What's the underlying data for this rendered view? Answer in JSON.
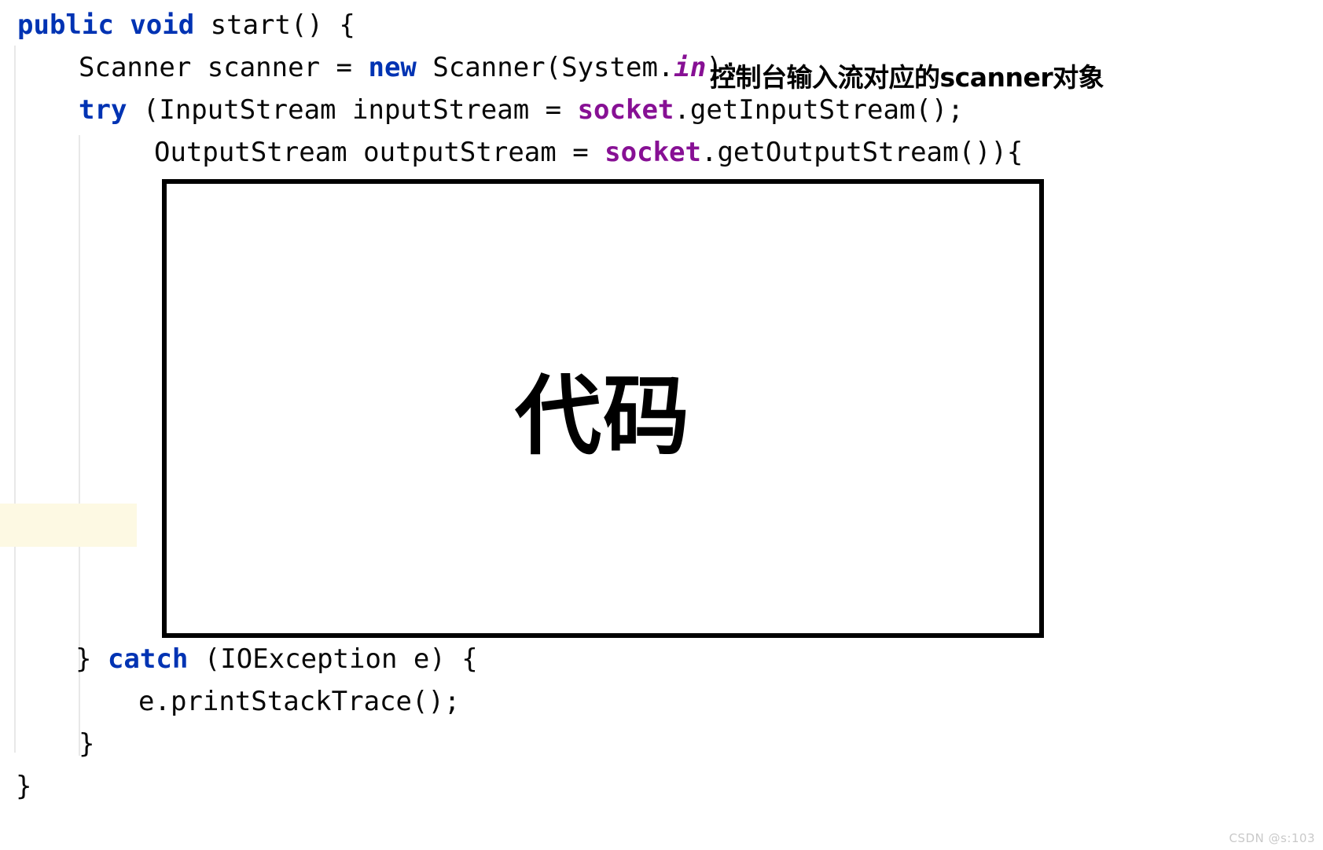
{
  "editor": {
    "background_color": "#ffffff",
    "highlight_band_color": "#fdf9e3",
    "guide_color": "#e8e8e8",
    "keyword_color": "#0033b3",
    "field_color": "#871094",
    "text_color": "#080808",
    "lines": [
      {
        "id": "line-1",
        "tokens": [
          {
            "text": "public void",
            "style": "keyword"
          },
          {
            "text": " start() {",
            "style": "plain"
          }
        ]
      },
      {
        "id": "line-2",
        "tokens": [
          {
            "text": "Scanner scanner = ",
            "style": "plain"
          },
          {
            "text": "new",
            "style": "keyword"
          },
          {
            "text": " Scanner(System.",
            "style": "plain"
          },
          {
            "text": "in",
            "style": "field-italic"
          },
          {
            "text": ");",
            "style": "plain"
          }
        ]
      },
      {
        "id": "line-3",
        "tokens": [
          {
            "text": "try",
            "style": "keyword"
          },
          {
            "text": " (InputStream inputStream = ",
            "style": "plain"
          },
          {
            "text": "socket",
            "style": "field"
          },
          {
            "text": ".getInputStream();",
            "style": "plain"
          }
        ]
      },
      {
        "id": "line-4",
        "tokens": [
          {
            "text": "OutputStream outputStream = ",
            "style": "plain"
          },
          {
            "text": "socket",
            "style": "field"
          },
          {
            "text": ".getOutputStream()){",
            "style": "plain"
          }
        ]
      },
      {
        "id": "line-5",
        "tokens": [
          {
            "text": "} ",
            "style": "plain"
          },
          {
            "text": "catch",
            "style": "keyword"
          },
          {
            "text": " (IOException e) {",
            "style": "plain"
          }
        ]
      },
      {
        "id": "line-6",
        "tokens": [
          {
            "text": "e.printStackTrace();",
            "style": "plain"
          }
        ]
      },
      {
        "id": "line-7",
        "tokens": [
          {
            "text": "}",
            "style": "plain"
          }
        ]
      },
      {
        "id": "line-8",
        "tokens": [
          {
            "text": "}",
            "style": "plain"
          }
        ]
      }
    ]
  },
  "annotation": {
    "text": "控制台输入流对应的scanner对象"
  },
  "code_box": {
    "label": "代码",
    "border_color": "#000000"
  },
  "watermark": {
    "text": "CSDN @s:103"
  }
}
